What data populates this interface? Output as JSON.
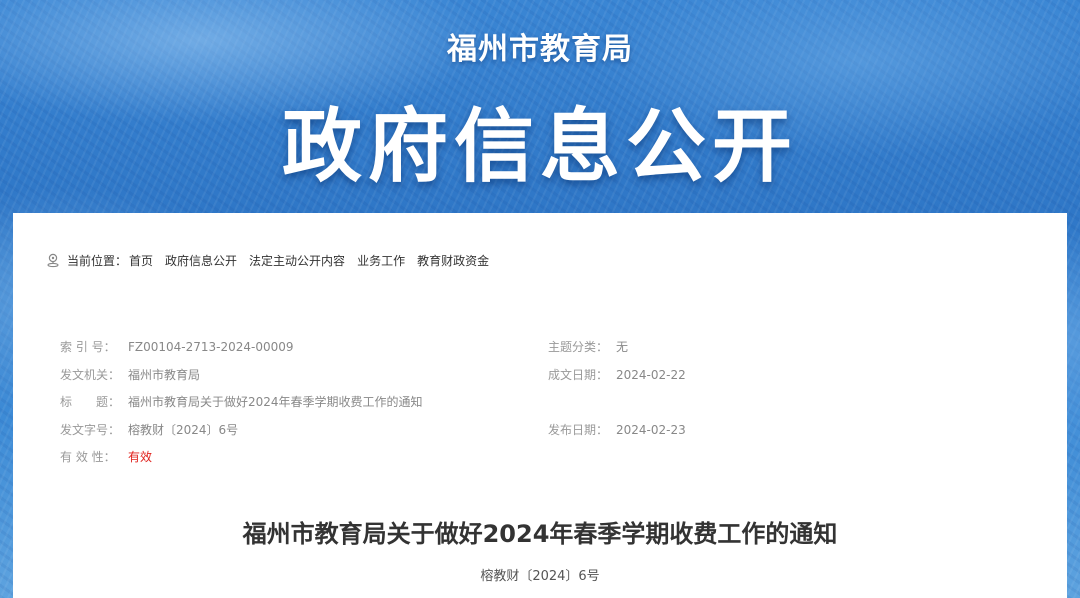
{
  "banner": {
    "subtitle": "福州市教育局",
    "title": "政府信息公开"
  },
  "breadcrumb": {
    "label": "当前位置：",
    "items": [
      "首页",
      "政府信息公开",
      "法定主动公开内容",
      "业务工作",
      "教育财政资金"
    ]
  },
  "meta": {
    "index_label": "索 引 号：",
    "index_value": "FZ00104-2713-2024-00009",
    "topic_label": "主题分类：",
    "topic_value": "无",
    "issuer_label": "发文机关：",
    "issuer_value": "福州市教育局",
    "created_label": "成文日期：",
    "created_value": "2024-02-22",
    "title_label": "标　　题：",
    "title_value": "福州市教育局关于做好2024年春季学期收费工作的通知",
    "docno_label": "发文字号：",
    "docno_value": "榕教财〔2024〕6号",
    "published_label": "发布日期：",
    "published_value": "2024-02-23",
    "validity_label": "有 效 性：",
    "validity_value": "有效"
  },
  "document": {
    "title": "福州市教育局关于做好2024年春季学期收费工作的通知",
    "number": "榕教财〔2024〕6号"
  },
  "colors": {
    "banner_blue": "#2f77c7",
    "validity_red": "#e0201b"
  }
}
